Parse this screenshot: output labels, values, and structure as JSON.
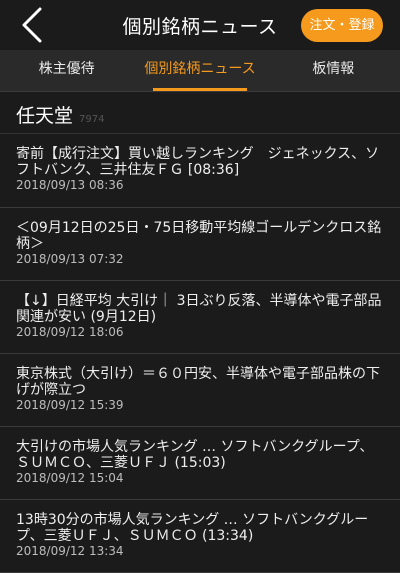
{
  "header": {
    "title": "個別銘柄ニュース",
    "order_button": "注文・登録"
  },
  "tabs": [
    {
      "label": "株主優待",
      "active": false
    },
    {
      "label": "個別銘柄ニュース",
      "active": true
    },
    {
      "label": "板情報",
      "active": false
    }
  ],
  "company": {
    "name": "任天堂",
    "code": "7974"
  },
  "news": [
    {
      "headline": "寄前【成行注文】買い越しランキング　ジェネックス、ソフトバンク、三井住友ＦＧ [08:36]",
      "date": "2018/09/13 08:36"
    },
    {
      "headline": "＜09月12日の25日・75日移動平均線ゴールデンクロス銘柄＞",
      "date": "2018/09/13 07:32"
    },
    {
      "headline": "【↓】日経平均 大引け｜ 3日ぶり反落、半導体や電子部品関連が安い (9月12日)",
      "date": "2018/09/12 18:06"
    },
    {
      "headline": "東京株式（大引け）＝６０円安、半導体や電子部品株の下げが際立つ",
      "date": "2018/09/12 15:39"
    },
    {
      "headline": "大引けの市場人気ランキング … ソフトバンクグループ、ＳＵＭＣＯ、三菱ＵＦＪ (15:03)",
      "date": "2018/09/12 15:04"
    },
    {
      "headline": "13時30分の市場人気ランキング … ソフトバンクグループ、三菱ＵＦＪ、ＳＵＭＣＯ (13:34)",
      "date": "2018/09/12 13:34"
    }
  ],
  "colors": {
    "accent": "#f59a1c",
    "background": "#1b1b1b",
    "tabbar": "#2a2a2a"
  }
}
